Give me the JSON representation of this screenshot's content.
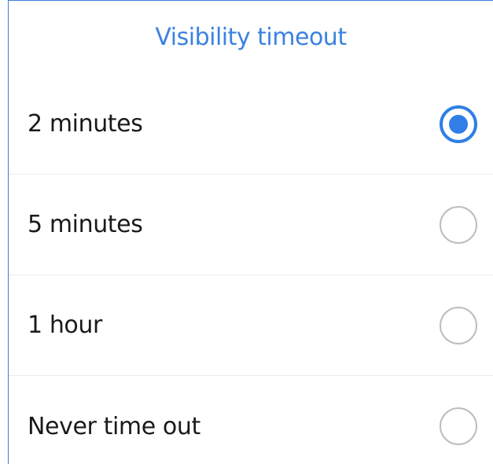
{
  "dialog": {
    "title": "Visibility timeout",
    "accent_color": "#3b82e0",
    "options": [
      {
        "label": "2 minutes",
        "selected": true
      },
      {
        "label": "5 minutes",
        "selected": false
      },
      {
        "label": "1 hour",
        "selected": false
      },
      {
        "label": "Never time out",
        "selected": false
      }
    ]
  }
}
